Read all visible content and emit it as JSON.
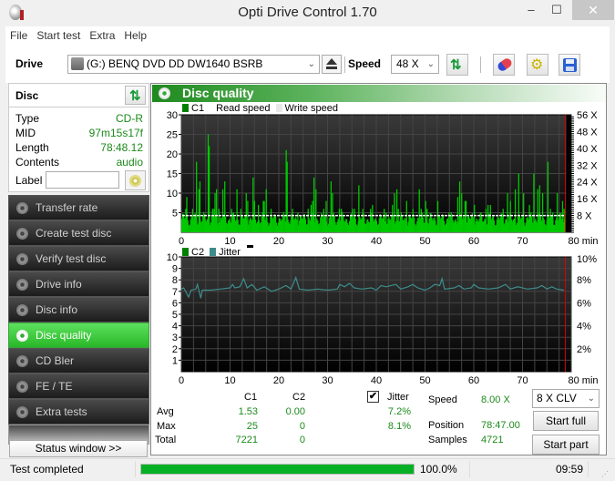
{
  "window": {
    "title": "Opti Drive Control 1.70",
    "minimize": "–",
    "maximize": "☐",
    "close": "✕"
  },
  "menu": [
    "File",
    "Start test",
    "Extra",
    "Help"
  ],
  "toolbar": {
    "drive_label": "Drive",
    "drive_value": "(G:)  BENQ DVD DD DW1640 BSRB",
    "speed_label": "Speed",
    "speed_value": "48 X",
    "chevron": "⌄"
  },
  "disc": {
    "title": "Disc",
    "rows": [
      {
        "key": "Type",
        "value": "CD-R"
      },
      {
        "key": "MID",
        "value": "97m15s17f"
      },
      {
        "key": "Length",
        "value": "78:48.12"
      },
      {
        "key": "Contents",
        "value": "audio"
      }
    ],
    "label_key": "Label",
    "label_value": ""
  },
  "nav": [
    {
      "label": "Transfer rate",
      "active": false
    },
    {
      "label": "Create test disc",
      "active": false
    },
    {
      "label": "Verify test disc",
      "active": false
    },
    {
      "label": "Drive info",
      "active": false
    },
    {
      "label": "Disc info",
      "active": false
    },
    {
      "label": "Disc quality",
      "active": true
    },
    {
      "label": "CD Bler",
      "active": false
    },
    {
      "label": "FE / TE",
      "active": false
    },
    {
      "label": "Extra tests",
      "active": false
    }
  ],
  "status_window_button": "Status window >>",
  "panel": {
    "title": "Disc quality"
  },
  "chart_data": [
    {
      "type": "bar",
      "title": "C1 / Read speed",
      "legend": [
        "C1",
        "Read speed",
        "Write speed"
      ],
      "colors": {
        "c1": "#00c800",
        "read_speed": "#ffffff",
        "end_marker": "#e00000"
      },
      "xlabel": "min",
      "xlim": [
        0,
        80
      ],
      "xticks": [
        "0",
        "10",
        "20",
        "30",
        "40",
        "50",
        "60",
        "70",
        "80 min"
      ],
      "ylim": [
        0,
        30
      ],
      "yticks": [
        "5",
        "10",
        "15",
        "20",
        "25",
        "30"
      ],
      "y2ticks": [
        "8 X",
        "16 X",
        "24 X",
        "32 X",
        "40 X",
        "48 X",
        "56 X"
      ],
      "y2lim": [
        0,
        56
      ],
      "end_minute": 78.8,
      "read_speed_x": 8,
      "c1_peaks": [
        [
          0.8,
          6
        ],
        [
          1.0,
          9
        ],
        [
          2.2,
          6
        ],
        [
          3.0,
          18
        ],
        [
          3.5,
          11
        ],
        [
          3.7,
          13
        ],
        [
          5.4,
          25
        ],
        [
          5.6,
          22
        ],
        [
          6.3,
          6
        ],
        [
          6.6,
          6
        ],
        [
          6.8,
          10
        ],
        [
          7.1,
          11
        ],
        [
          7.6,
          6
        ],
        [
          8.4,
          11
        ],
        [
          8.8,
          13
        ],
        [
          10.2,
          6
        ],
        [
          11.3,
          11
        ],
        [
          12.1,
          6
        ],
        [
          13.2,
          10
        ],
        [
          13.5,
          8
        ],
        [
          14.6,
          14
        ],
        [
          14.9,
          8
        ],
        [
          15.7,
          7
        ],
        [
          16.7,
          8
        ],
        [
          16.9,
          8
        ],
        [
          17.3,
          11
        ],
        [
          18.3,
          6
        ],
        [
          21.4,
          21
        ],
        [
          21.6,
          18
        ],
        [
          22.7,
          6
        ],
        [
          23.8,
          5
        ],
        [
          25.9,
          6
        ],
        [
          26.5,
          7
        ],
        [
          26.8,
          8
        ],
        [
          27.1,
          14
        ],
        [
          27.5,
          11
        ],
        [
          29.1,
          6
        ],
        [
          29.6,
          8
        ],
        [
          30.6,
          13
        ],
        [
          30.9,
          10
        ],
        [
          32.3,
          6
        ],
        [
          32.7,
          6
        ],
        [
          35.0,
          6
        ],
        [
          35.4,
          6
        ],
        [
          36.3,
          12
        ],
        [
          37.1,
          6
        ],
        [
          38.7,
          6
        ],
        [
          39.1,
          7
        ],
        [
          41.5,
          6
        ],
        [
          41.9,
          5
        ],
        [
          43.2,
          7
        ],
        [
          43.6,
          10
        ],
        [
          44.1,
          11
        ],
        [
          44.4,
          6
        ],
        [
          46.1,
          8
        ],
        [
          47.4,
          6
        ],
        [
          48.7,
          11
        ],
        [
          49.1,
          6
        ],
        [
          50.0,
          8
        ],
        [
          50.3,
          6
        ],
        [
          52.5,
          8
        ],
        [
          54.8,
          5
        ],
        [
          56.6,
          9
        ],
        [
          57.0,
          13
        ],
        [
          57.4,
          10
        ],
        [
          58.1,
          8
        ],
        [
          58.3,
          8
        ],
        [
          60.0,
          7
        ],
        [
          62.4,
          6
        ],
        [
          62.8,
          7
        ],
        [
          63.3,
          7
        ],
        [
          65.9,
          6
        ],
        [
          66.8,
          10
        ],
        [
          67.4,
          8
        ],
        [
          68.4,
          11
        ],
        [
          69.1,
          15
        ],
        [
          70.1,
          10
        ],
        [
          71.3,
          7
        ],
        [
          72.2,
          15
        ],
        [
          73.0,
          11
        ],
        [
          73.4,
          12
        ],
        [
          74.0,
          10
        ],
        [
          75.1,
          18
        ],
        [
          75.6,
          6
        ],
        [
          76.1,
          5
        ],
        [
          77.0,
          10
        ],
        [
          78.1,
          8
        ],
        [
          78.4,
          6
        ]
      ]
    },
    {
      "type": "line",
      "title": "C2 / Jitter",
      "legend": [
        "C2",
        "Jitter"
      ],
      "colors": {
        "c2": "#008000",
        "jitter": "#3c8c8a",
        "end_marker": "#e00000"
      },
      "xlabel": "min",
      "xlim": [
        0,
        80
      ],
      "xticks": [
        "0",
        "10",
        "20",
        "30",
        "40",
        "50",
        "60",
        "70",
        "80 min"
      ],
      "ylim": [
        0,
        10
      ],
      "yticks": [
        "1",
        "2",
        "3",
        "4",
        "5",
        "6",
        "7",
        "8",
        "9",
        "10"
      ],
      "y2ticks": [
        "2%",
        "4%",
        "6%",
        "8%",
        "10%"
      ],
      "y2lim": [
        0,
        10
      ],
      "end_minute": 78.8,
      "c2_values": "all 0",
      "jitter_points": [
        [
          0,
          7.2
        ],
        [
          0.5,
          7.3
        ],
        [
          1,
          6.9
        ],
        [
          1.5,
          6.5
        ],
        [
          2,
          7.1
        ],
        [
          3,
          7.2
        ],
        [
          3.3,
          7.6
        ],
        [
          4,
          6.4
        ],
        [
          4.3,
          7.1
        ],
        [
          6,
          7.1
        ],
        [
          8,
          7.2
        ],
        [
          10,
          7.3
        ],
        [
          10.5,
          7.6
        ],
        [
          11,
          7.3
        ],
        [
          12,
          7.4
        ],
        [
          12.8,
          8.1
        ],
        [
          13.5,
          7.3
        ],
        [
          14.5,
          7.6
        ],
        [
          15.5,
          7.1
        ],
        [
          17,
          7.4
        ],
        [
          18.5,
          7.0
        ],
        [
          20,
          7.2
        ],
        [
          21.5,
          7.5
        ],
        [
          22.5,
          7.2
        ],
        [
          23.5,
          8.2
        ],
        [
          24.2,
          7.2
        ],
        [
          26,
          7.1
        ],
        [
          28,
          7.2
        ],
        [
          30,
          7.1
        ],
        [
          32,
          7.2
        ],
        [
          32.5,
          7.6
        ],
        [
          33.5,
          7.4
        ],
        [
          34.5,
          7.7
        ],
        [
          35.5,
          7.3
        ],
        [
          37,
          7.2
        ],
        [
          39,
          7.3
        ],
        [
          40,
          7.1
        ],
        [
          41,
          7.5
        ],
        [
          42,
          7.4
        ],
        [
          44,
          7.6
        ],
        [
          45,
          7.2
        ],
        [
          46.5,
          7.4
        ],
        [
          47.5,
          7.6
        ],
        [
          48.5,
          7.3
        ],
        [
          50,
          7.1
        ],
        [
          51,
          7.3
        ],
        [
          52,
          7.6
        ],
        [
          53,
          7.5
        ],
        [
          53.5,
          8.1
        ],
        [
          54,
          7.2
        ],
        [
          56,
          7.3
        ],
        [
          57,
          7.5
        ],
        [
          58,
          7.2
        ],
        [
          59.5,
          7.3
        ],
        [
          60,
          7.6
        ],
        [
          61,
          7.3
        ],
        [
          63,
          7.2
        ],
        [
          65,
          7.3
        ],
        [
          66.5,
          7.6
        ],
        [
          67.5,
          7.2
        ],
        [
          69,
          7.4
        ],
        [
          71,
          7.2
        ],
        [
          73,
          7.3
        ],
        [
          74,
          7.5
        ],
        [
          75,
          7.2
        ],
        [
          76,
          7.4
        ],
        [
          77,
          7.2
        ],
        [
          78.5,
          7.1
        ]
      ]
    }
  ],
  "stats": {
    "headers": {
      "c1": "C1",
      "c2": "C2",
      "jitter": "Jitter"
    },
    "jitter_checked": true,
    "check_glyph": "✔",
    "rows": [
      {
        "label": "Avg",
        "c1": "1.53",
        "c2": "0.00",
        "jitter": "7.2%"
      },
      {
        "label": "Max",
        "c1": "25",
        "c2": "0",
        "jitter": "8.1%"
      },
      {
        "label": "Total",
        "c1": "7221",
        "c2": "0",
        "jitter": ""
      }
    ]
  },
  "run_info": {
    "speed_label": "Speed",
    "speed_value": "8.00 X",
    "position_label": "Position",
    "position_value": "78:47.00",
    "samples_label": "Samples",
    "samples_value": "4721",
    "mode_value": "8 X CLV",
    "start_full": "Start full",
    "start_part": "Start part"
  },
  "statusbar": {
    "text": "Test completed",
    "progress_pct": 100,
    "progress_text": "100.0%",
    "time": "09:59"
  }
}
